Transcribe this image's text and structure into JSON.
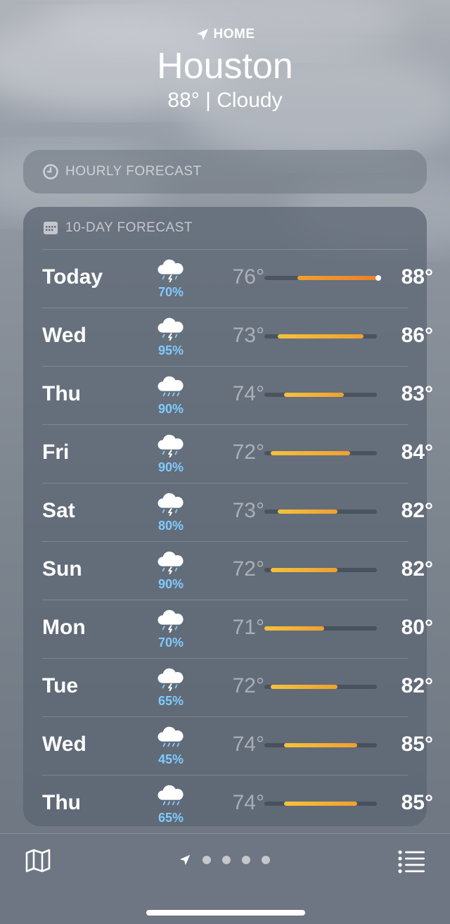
{
  "header": {
    "location_label": "HOME",
    "city": "Houston",
    "current": "88°  |  Cloudy",
    "icon": "location-arrow-icon"
  },
  "hourly": {
    "label": "HOURLY FORECAST",
    "icon": "clock-icon"
  },
  "daily": {
    "label": "10-DAY FORECAST",
    "icon": "calendar-icon",
    "range_min": 71,
    "range_max": 88,
    "days": [
      {
        "day": "Today",
        "precip": "70%",
        "low": "76°",
        "high": "88°",
        "low_val": 76,
        "high_val": 88,
        "current": true,
        "icon": "thunderstorm-icon"
      },
      {
        "day": "Wed",
        "precip": "95%",
        "low": "73°",
        "high": "86°",
        "low_val": 73,
        "high_val": 86,
        "icon": "thunderstorm-icon"
      },
      {
        "day": "Thu",
        "precip": "90%",
        "low": "74°",
        "high": "83°",
        "low_val": 74,
        "high_val": 83,
        "icon": "rain-icon"
      },
      {
        "day": "Fri",
        "precip": "90%",
        "low": "72°",
        "high": "84°",
        "low_val": 72,
        "high_val": 84,
        "icon": "thunderstorm-icon"
      },
      {
        "day": "Sat",
        "precip": "80%",
        "low": "73°",
        "high": "82°",
        "low_val": 73,
        "high_val": 82,
        "icon": "thunderstorm-icon"
      },
      {
        "day": "Sun",
        "precip": "90%",
        "low": "72°",
        "high": "82°",
        "low_val": 72,
        "high_val": 82,
        "icon": "thunderstorm-icon"
      },
      {
        "day": "Mon",
        "precip": "70%",
        "low": "71°",
        "high": "80°",
        "low_val": 71,
        "high_val": 80,
        "icon": "thunderstorm-icon"
      },
      {
        "day": "Tue",
        "precip": "65%",
        "low": "72°",
        "high": "82°",
        "low_val": 72,
        "high_val": 82,
        "icon": "thunderstorm-icon"
      },
      {
        "day": "Wed",
        "precip": "45%",
        "low": "74°",
        "high": "85°",
        "low_val": 74,
        "high_val": 85,
        "icon": "rain-icon"
      },
      {
        "day": "Thu",
        "precip": "65%",
        "low": "74°",
        "high": "85°",
        "low_val": 74,
        "high_val": 85,
        "icon": "rain-icon"
      }
    ]
  },
  "toolbar": {
    "map_icon": "map-icon",
    "list_icon": "list-icon",
    "page_count": 4
  },
  "colors": {
    "precip": "#7fcbff",
    "bar_warm": "#f0a030",
    "bar_hot": "#ec7f2e",
    "bar_mild": "#f4c23c"
  }
}
